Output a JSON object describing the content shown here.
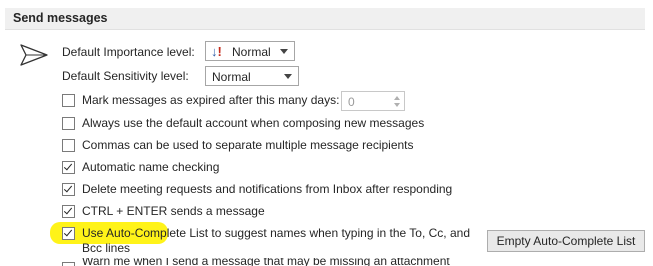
{
  "section": {
    "title": "Send messages"
  },
  "importance": {
    "label": "Default Importance level:",
    "value": "Normal"
  },
  "sensitivity": {
    "label": "Default Sensitivity level:",
    "value": "Normal"
  },
  "expire": {
    "label": "Mark messages as expired after this many days:",
    "value": "0",
    "checked": false
  },
  "options": [
    {
      "label": "Always use the default account when composing new messages",
      "checked": false
    },
    {
      "label": "Commas can be used to separate multiple message recipients",
      "checked": false
    },
    {
      "label": "Automatic name checking",
      "checked": true
    },
    {
      "label": "Delete meeting requests and notifications from Inbox after responding",
      "checked": true
    },
    {
      "label": "CTRL + ENTER sends a message",
      "checked": true
    },
    {
      "label": "Use Auto-Complete List to suggest names when typing in the To, Cc, and",
      "label_line2": "Bcc lines",
      "checked": true
    }
  ],
  "empty_autocomplete_button": "Empty Auto-Complete List",
  "cut_option": {
    "label": "Warn me when I send a message that may be missing an attachment"
  },
  "colors": {
    "highlight": "#fff200",
    "header_bg": "#f0f0f0"
  },
  "icons": {
    "send": "paper-plane-icon",
    "importance": "importance-arrow-icon"
  }
}
